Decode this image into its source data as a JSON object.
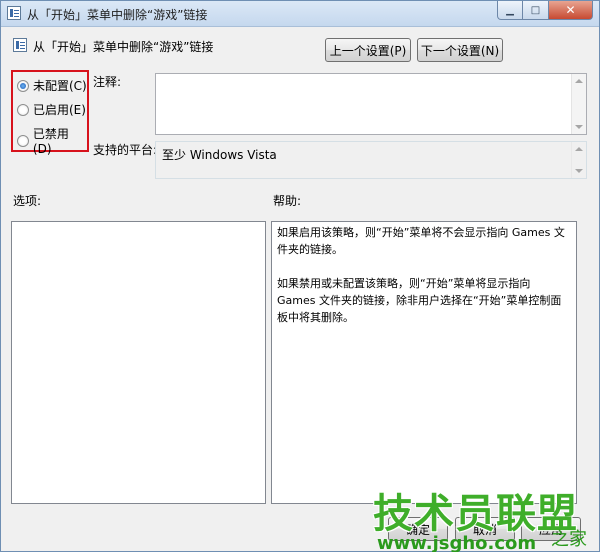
{
  "window": {
    "title": "从「开始」菜单中删除“游戏”链接",
    "close_glyph": "✕",
    "min_glyph": "▁",
    "max_glyph": "□"
  },
  "header": {
    "policy_name": "从「开始」菜单中删除“游戏”链接",
    "prev_button": "上一个设置(P)",
    "next_button": "下一个设置(N)"
  },
  "state_options": [
    {
      "label": "未配置(C)",
      "checked": true
    },
    {
      "label": "已启用(E)",
      "checked": false
    },
    {
      "label": "已禁用(D)",
      "checked": false
    }
  ],
  "comment": {
    "label": "注释:",
    "value": ""
  },
  "platform": {
    "label": "支持的平台:",
    "value": "至少 Windows Vista"
  },
  "options": {
    "label": "选项:"
  },
  "help": {
    "label": "帮助:",
    "paragraphs": [
      "如果启用该策略，则“开始”菜单将不会显示指向 Games 文件夹的链接。",
      "如果禁用或未配置该策略，则“开始”菜单将显示指向 Games 文件夹的链接，除非用户选择在“开始”菜单控制面板中将其删除。"
    ]
  },
  "footer": {
    "ok_button": "确定",
    "cancel_button": "取消",
    "apply_button": "应用"
  },
  "watermark": {
    "brand": "技术员联盟",
    "url": "www.jsgho.com",
    "home": "之家"
  },
  "colors": {
    "highlight_border": "#d7121c",
    "watermark_green": "#3fae2a"
  }
}
